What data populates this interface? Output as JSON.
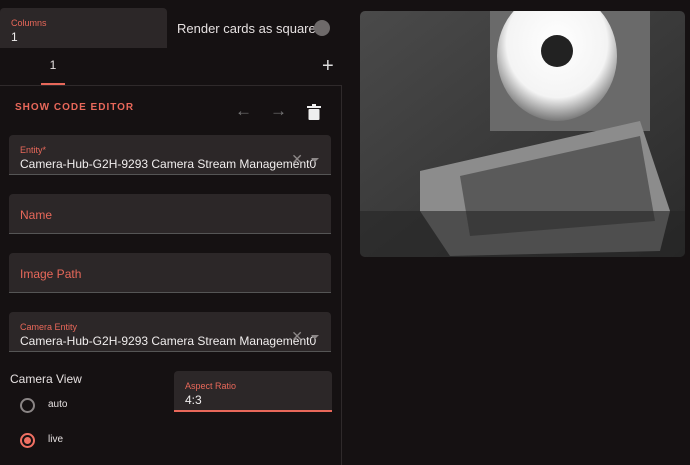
{
  "columns": {
    "label": "Columns",
    "value": "1"
  },
  "square_toggle": {
    "label": "Render cards as squares",
    "on": false
  },
  "tabs": [
    {
      "label": "1",
      "active": true
    }
  ],
  "add_tab_icon": "plus-icon",
  "editor": {
    "show_code_label": "SHOW CODE EDITOR",
    "toolbar_icons": [
      "arrow-left-icon",
      "arrow-right-icon",
      "trash-icon"
    ],
    "entity": {
      "label": "Entity*",
      "value": "Camera-Hub-G2H-9293 Camera Stream Management0"
    },
    "name": {
      "placeholder": "Name"
    },
    "image_path": {
      "placeholder": "Image Path"
    },
    "camera_entity": {
      "label": "Camera Entity",
      "value": "Camera-Hub-G2H-9293 Camera Stream Management0"
    },
    "camera_view": {
      "label": "Camera View",
      "options": [
        {
          "label": "auto",
          "selected": false
        },
        {
          "label": "live",
          "selected": true
        }
      ]
    },
    "aspect_ratio": {
      "label": "Aspect Ratio",
      "value": "4:3"
    }
  },
  "colors": {
    "accent": "#e8685a",
    "background": "#151112",
    "field": "#2c2728"
  }
}
